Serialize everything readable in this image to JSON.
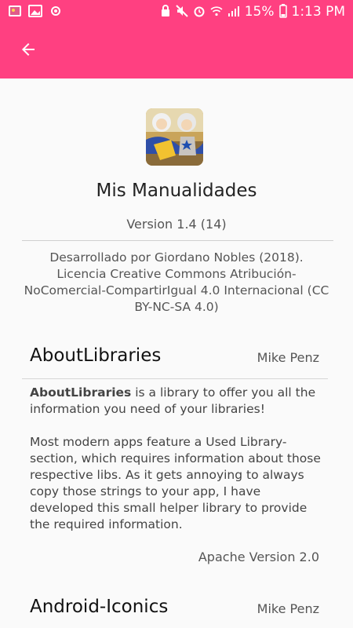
{
  "status_bar": {
    "battery": "15%",
    "time": "1:13 PM",
    "icons_left": [
      "gallery-icon",
      "image-icon",
      "settings-notification-icon"
    ],
    "icons_right": [
      "alarm-lock-icon",
      "mute-icon",
      "alarm-icon",
      "wifi-icon",
      "signal-icon",
      "battery-icon"
    ]
  },
  "app_bar": {
    "color": "#ff4081",
    "back_icon": "arrow-left-icon"
  },
  "app": {
    "name": "Mis Manualidades",
    "version": "Version 1.4 (14)",
    "description": "Desarrollado por Giordano Nobles (2018). Licencia Creative Commons Atribución-NoComercial-CompartirIgual 4.0 Internacional (CC BY-NC-SA 4.0)"
  },
  "libraries": [
    {
      "title": "AboutLibraries",
      "author": "Mike Penz",
      "desc_bold": "AboutLibraries",
      "desc_rest": " is a library to offer you all the information you need of your libraries!\n\nMost modern apps feature a Used Library-section, which requires information about those respective libs. As it gets annoying to always copy those strings to your app, I have developed this small helper library to provide the required information.",
      "license": "Apache Version 2.0"
    },
    {
      "title": "Android-Iconics",
      "author": "Mike Penz"
    }
  ]
}
